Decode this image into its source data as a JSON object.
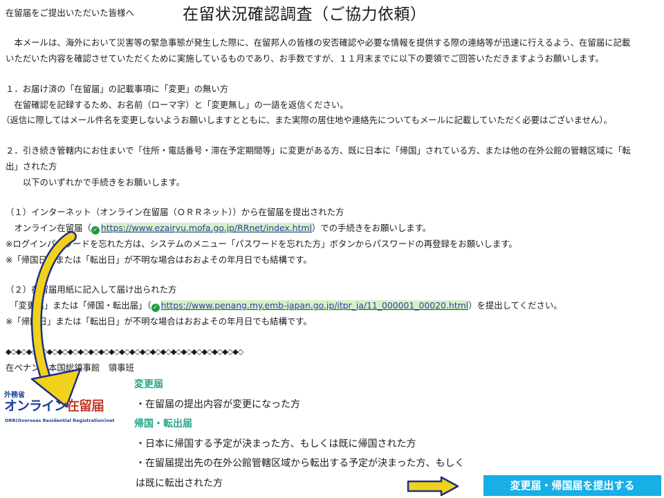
{
  "header": {
    "salutation": "在留届をご提出いただいた皆様へ",
    "title": "在留状況確認調査（ご協力依頼）"
  },
  "intro": {
    "line1": "　本メールは、海外において災害等の緊急事態が発生した際に、在留邦人の皆様の安否確認や必要な情報を提供する際の連絡等が迅速に行えるよう、在留届に記載",
    "line2": "いただいた内容を確認させていただくために実施しているものであり、お手数ですが、１１月末までに以下の要領でご回答いただきますようお願いします。"
  },
  "section1": {
    "heading": "１．お届け済の「在留届」の記載事項に「変更」の無い方",
    "body": "　在留確認を記録するため、お名前（ローマ字）と「変更無し」の一語を返信ください。",
    "note": "（返信に際してはメール件名を変更しないようお願いしますとともに、また実際の居住地や連絡先についてもメールに記載していただく必要はございません）。"
  },
  "section2": {
    "heading_line1": "２．引き続き管轄内にお住まいで「住所・電話番号・滞在予定期間等」に変更がある方、既に日本に「帰国」されている方、または他の在外公館の管轄区域に「転",
    "heading_line2": "出」された方",
    "body": "　　以下のいずれかで手続きをお願いします。"
  },
  "option1": {
    "heading": "（１）インターネット（オンライン在留届（ＯＲＲネット））から在留届を提出された方",
    "prefix": "　オンライン在留届（",
    "url": "https://www.ezairyu.mofa.go.jp/RRnet/index.html",
    "suffix": "）での手続きをお願いします。",
    "note1": "※ログインパスワードを忘れた方は、システムのメニュー「パスワードを忘れた方」ボタンからパスワードの再登録をお願いします。",
    "note2": "※「帰国日」または「転出日」が不明な場合はおおよその年月日でも結構です。"
  },
  "option2": {
    "heading": "（２）在留届用紙に記入して届け出られた方",
    "prefix": "　「変更届」または「帰国・転出届」（",
    "url": "https://www.penang.my.emb-japan.go.jp/itpr_ja/11_000001_00020.html",
    "suffix": "）を提出してください。",
    "note": "※「帰国日」または「転出日」が不明な場合はおおよその年月日でも結構です。"
  },
  "footer": {
    "diamonds": "◆◇◆◇◆◇◆◇◆◇◆◇◆◇◆◇◆◇◆◇◆◇◆◇◆◇◆◇◆◇◆◇◆◇◆◇◆◇◆◇◆◇◆◇◆◇",
    "sender": "在ペナン日本国総領事館　領事班"
  },
  "logo": {
    "small": "外務省",
    "big_blue": "オンライン",
    "big_red": "在留届",
    "sub": "ORR(Overseas Residential Registration)net"
  },
  "info": {
    "change_heading": "変更届",
    "change_item": "・在留届の提出内容が変更になった方",
    "return_heading": "帰国・転出届",
    "return_item1": "・日本に帰国する予定が決まった方、もしくは既に帰国された方",
    "return_item2a": "・在留届提出先の在外公館管轄区域から転出する予定が決まった方、もしく",
    "return_item2b": "は既に転出された方"
  },
  "button": {
    "label": "変更届・帰国届を提出する"
  },
  "colors": {
    "accent_green": "#2aa58a",
    "button_blue": "#18aee6",
    "arrow_yellow": "#f0d21a",
    "link_highlight": "#d8f0c8"
  }
}
